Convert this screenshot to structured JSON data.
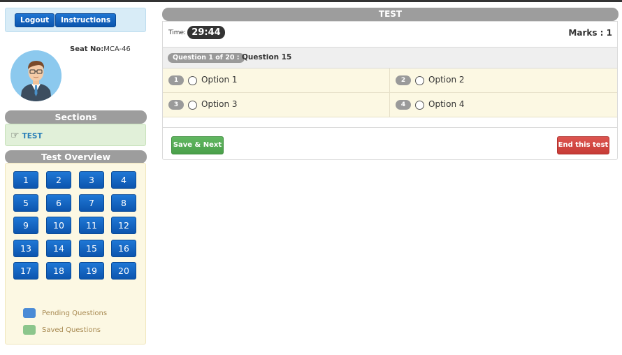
{
  "header": {
    "logout_label": "Logout",
    "instructions_label": "Instructions"
  },
  "profile": {
    "seat_label": "Seat No:",
    "seat_value": "MCA-46",
    "avatar_icon": "user-avatar-icon"
  },
  "sections": {
    "title": "Sections",
    "items": [
      {
        "label": "TEST",
        "icon": "pointing-hand-icon"
      }
    ]
  },
  "overview": {
    "title": "Test Overview",
    "questions": [
      "1",
      "2",
      "3",
      "4",
      "5",
      "6",
      "7",
      "8",
      "9",
      "10",
      "11",
      "12",
      "13",
      "14",
      "15",
      "16",
      "17",
      "18",
      "19",
      "20"
    ],
    "legend": [
      {
        "label": "Pending Questions",
        "color": "#4a8bd6"
      },
      {
        "label": "Saved Questions",
        "color": "#8cc68c"
      }
    ]
  },
  "test": {
    "title": "TEST",
    "time_label": "Time:",
    "time_value": "29:44",
    "marks": "Marks : 1",
    "question_counter": "Question 1 of 20 :",
    "question_text": "Question 15",
    "options": [
      {
        "num": "1",
        "label": "Option 1"
      },
      {
        "num": "2",
        "label": "Option 2"
      },
      {
        "num": "3",
        "label": "Option 3"
      },
      {
        "num": "4",
        "label": "Option 4"
      }
    ],
    "save_next_label": "Save & Next",
    "end_test_label": "End this test"
  },
  "colors": {
    "primary_blue": "#1565c0",
    "save_green": "#5cb85c",
    "end_red": "#d9534f",
    "header_grey": "#9d9d9d"
  }
}
